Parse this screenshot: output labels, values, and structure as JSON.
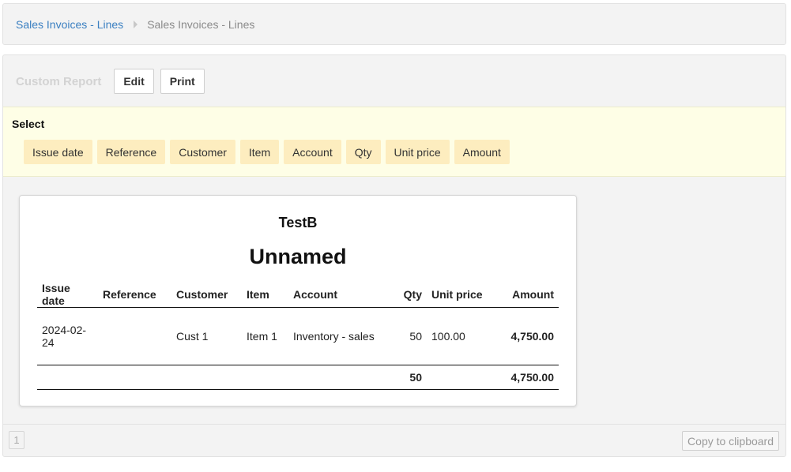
{
  "breadcrumb": {
    "link": "Sales Invoices - Lines",
    "current": "Sales Invoices - Lines"
  },
  "toolbar": {
    "report_title": "Custom Report",
    "edit_label": "Edit",
    "print_label": "Print"
  },
  "select": {
    "label": "Select",
    "chips": [
      "Issue date",
      "Reference",
      "Customer",
      "Item",
      "Account",
      "Qty",
      "Unit price",
      "Amount"
    ]
  },
  "report": {
    "company": "TestB",
    "title": "Unnamed",
    "columns": [
      "Issue date",
      "Reference",
      "Customer",
      "Item",
      "Account",
      "Qty",
      "Unit price",
      "Amount"
    ],
    "rows": [
      [
        "2024-02-24",
        "",
        "Cust 1",
        "Item 1",
        "Inventory - sales",
        "50",
        "100.00",
        "4,750.00"
      ]
    ],
    "totals": {
      "qty": "50",
      "amount": "4,750.00"
    }
  },
  "footer": {
    "page": "1",
    "copy_label": "Copy to clipboard"
  }
}
